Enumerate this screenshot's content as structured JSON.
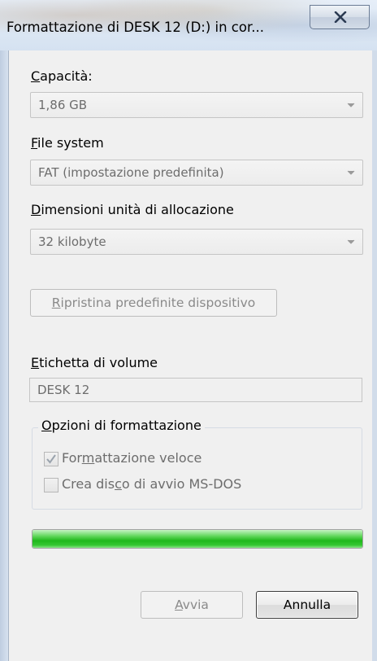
{
  "window": {
    "title": "Formattazione di DESK 12 (D:) in cor..."
  },
  "capacity": {
    "label": "Capacità:",
    "label_hotkey": "C",
    "label_rest": "apacità:",
    "value": "1,86 GB"
  },
  "file_system": {
    "label_hotkey": "F",
    "label_rest": "ile system",
    "value": "FAT (impostazione predefinita)"
  },
  "allocation": {
    "label_hotkey": "D",
    "label_rest": "imensioni unità di allocazione",
    "value": "32 kilobyte"
  },
  "restore_button": {
    "hotkey": "R",
    "rest": "ipristina predefinite dispositivo"
  },
  "volume_label": {
    "label_hotkey": "E",
    "label_rest": "tichetta di volume",
    "value": "DESK 12"
  },
  "format_options": {
    "title_hotkey": "O",
    "title_rest": "pzioni di formattazione",
    "quick_format": {
      "label_pre": "For",
      "label_hotkey": "m",
      "label_post": "attazione veloce",
      "checked": true
    },
    "msdos_disk": {
      "label_pre": "Crea dis",
      "label_hotkey": "c",
      "label_post": "o di avvio MS-DOS",
      "checked": false
    }
  },
  "progress": {
    "percent": 100,
    "color": "#20b81c"
  },
  "buttons": {
    "start_hotkey": "A",
    "start_rest": "vvia",
    "cancel": "Annulla"
  },
  "icons": {
    "close": "close-icon",
    "dropdown": "chevron-down-icon",
    "check": "checkmark-icon"
  }
}
